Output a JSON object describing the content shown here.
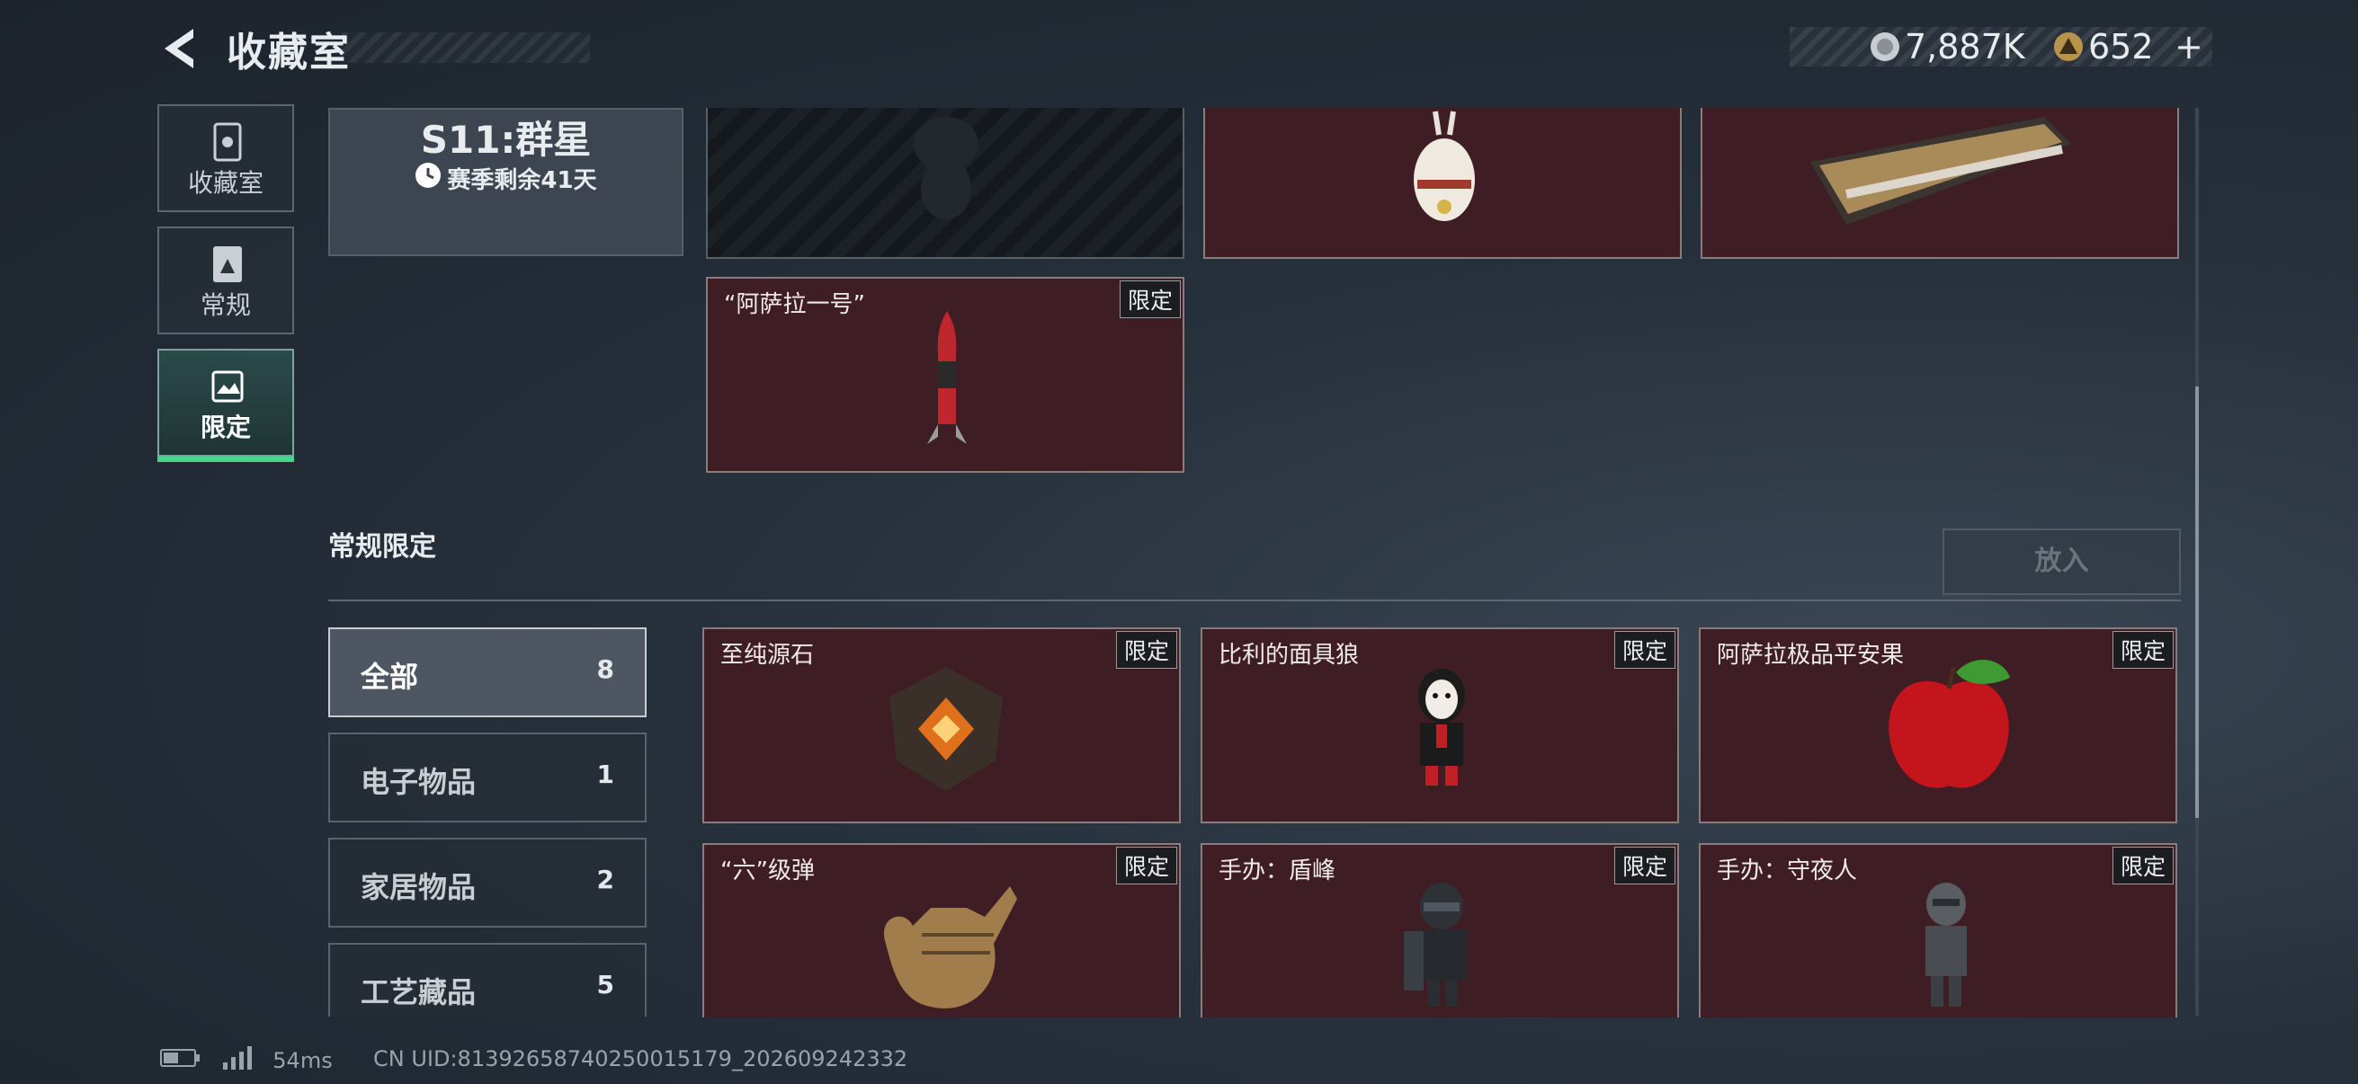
{
  "header": {
    "title": "收藏室",
    "currency": [
      {
        "icon": "silver-coin-icon",
        "value": "7,887K"
      },
      {
        "icon": "gold-triangle-coin-icon",
        "value": "652"
      }
    ],
    "add_label": "+"
  },
  "sidebar": {
    "items": [
      {
        "label": "收藏室",
        "icon": "collection-room-icon",
        "active": false
      },
      {
        "label": "常规",
        "icon": "regular-book-icon",
        "active": false
      },
      {
        "label": "限定",
        "icon": "limited-image-icon",
        "active": true
      }
    ]
  },
  "season": {
    "title": "S11:群星",
    "remaining": "赛季剩余41天"
  },
  "season_items": [
    {
      "name": "",
      "tag": ""
    },
    {
      "name": "",
      "tag": ""
    },
    {
      "name": "",
      "tag": ""
    },
    {
      "name": "“阿萨拉一号”",
      "tag": "限定"
    }
  ],
  "section": {
    "title": "常规限定",
    "put_button": "放入"
  },
  "categories": [
    {
      "label": "全部",
      "count": "8",
      "active": true
    },
    {
      "label": "电子物品",
      "count": "1",
      "active": false
    },
    {
      "label": "家居物品",
      "count": "2",
      "active": false
    },
    {
      "label": "工艺藏品",
      "count": "5",
      "active": false
    }
  ],
  "items": [
    {
      "name": "至纯源石",
      "tag": "限定",
      "icon": "source-stone-icon"
    },
    {
      "name": "比利的面具狼",
      "tag": "限定",
      "icon": "billy-puppet-icon"
    },
    {
      "name": "阿萨拉极品平安果",
      "tag": "限定",
      "icon": "red-apple-icon"
    },
    {
      "name": "“六”级弹",
      "tag": "限定",
      "icon": "golden-hand-gesture-icon"
    },
    {
      "name": "手办：盾峰",
      "tag": "限定",
      "icon": "shield-soldier-figure-icon"
    },
    {
      "name": "手办：守夜人",
      "tag": "限定",
      "icon": "night-watch-figure-icon"
    }
  ],
  "footer": {
    "ping": "54ms",
    "uid": "CN UID:81392658740250015179_202609242332"
  },
  "colors": {
    "accent_green": "#46d48e",
    "card_bg": "#3e1e24"
  }
}
